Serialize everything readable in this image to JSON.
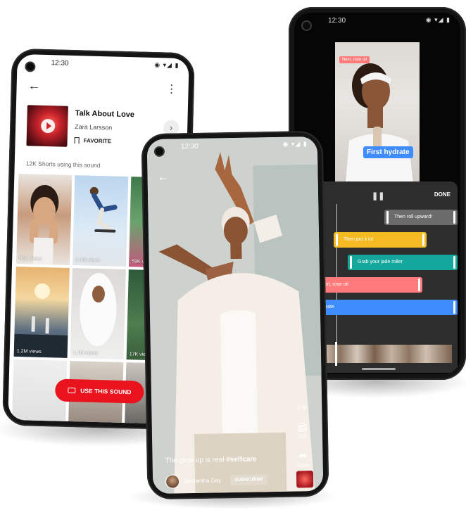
{
  "phones": {
    "sound": {
      "status_time": "12:30",
      "status_icons": "◉ ▾◢ ▮",
      "back_icon": "←",
      "more_icon": "⋮",
      "song_title": "Talk About Love",
      "artist": "Zara Larsson",
      "favorite_label": "FAVORITE",
      "next_icon": "›",
      "shorts_count": "12K Shorts using this sound",
      "tiles": [
        {
          "views": "96K views"
        },
        {
          "views": "1.4M views"
        },
        {
          "views": "59K views"
        },
        {
          "views": "1.2M views"
        },
        {
          "views": "1.1M views"
        },
        {
          "views": "17K views"
        },
        {
          "views": ""
        },
        {
          "views": ""
        },
        {
          "views": ""
        }
      ],
      "use_sound_label": "USE THIS SOUND",
      "accent_color": "#e8131d"
    },
    "player": {
      "status_time": "12:30",
      "status_icons": "◉ ▾◢ ▮",
      "back_icon": "←",
      "like_count": "3.2K",
      "comment_icon": "▤",
      "comment_count": "12K",
      "share_icon": "➦",
      "share_label": "Share",
      "caption_text": "The glow up is real ",
      "caption_tag": "#selfcare",
      "channel_name": "Samantha Day",
      "subscribe_label": "SUBSCRIBE"
    },
    "editor": {
      "status_time": "12:30",
      "status_icons": "◉ ▾◢ ▮",
      "preview_tag_top": "Next, rose oil",
      "preview_tag_main": "First hydrate",
      "pause_icon": "❚❚",
      "done_label": "DONE",
      "clips": [
        {
          "label": "Then roll upward!",
          "color": "#6b6b6b"
        },
        {
          "label": "Then put it in!",
          "color": "#f5b922"
        },
        {
          "label": "Grab your jade roller",
          "color": "#14a89c"
        },
        {
          "label": "Next, rose oil",
          "color": "#ff7a78"
        },
        {
          "label": "First hydrate",
          "color": "#3f8cff"
        }
      ]
    }
  }
}
